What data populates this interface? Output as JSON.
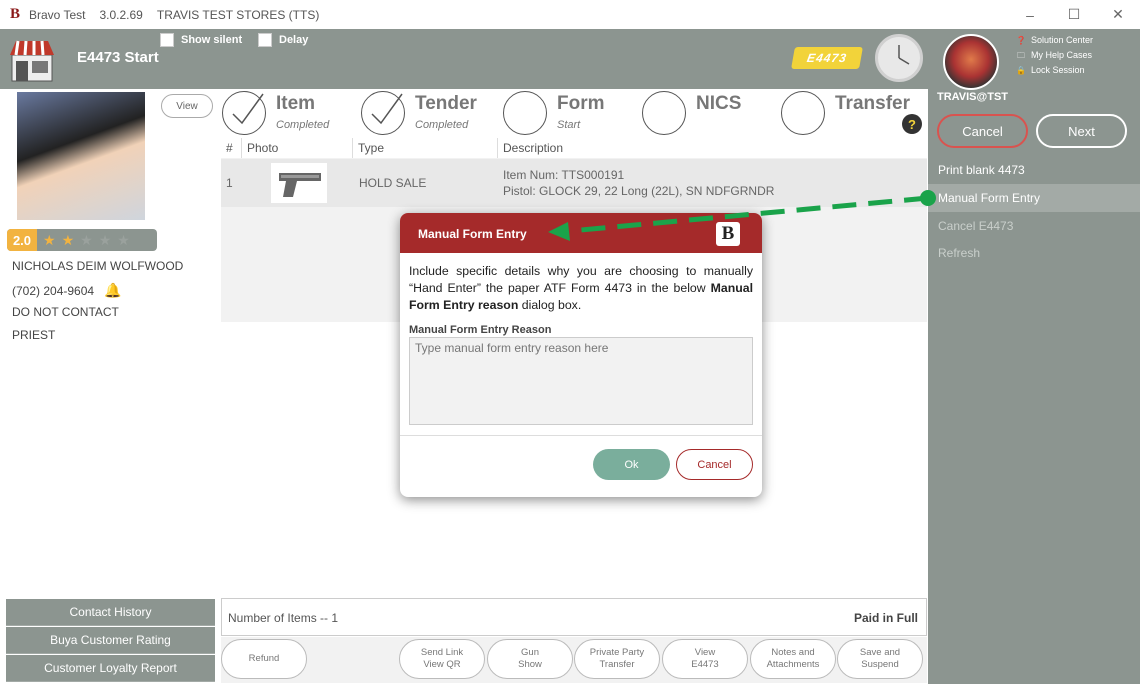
{
  "titlebar": {
    "app": "Bravo Test",
    "version": "3.0.2.69",
    "store": "TRAVIS TEST STORES (TTS)",
    "minimize": "–",
    "maximize": "☐",
    "close": "✕"
  },
  "header": {
    "title": "E4473 Start",
    "show_silent": "Show silent",
    "delay": "Delay",
    "badge": "E4473"
  },
  "account": {
    "username": "TRAVIS@TST",
    "links": [
      "Solution Center",
      "My Help Cases",
      "Lock Session"
    ],
    "cancel": "Cancel",
    "next": "Next",
    "menu": [
      {
        "label": "Print blank 4473",
        "state": "normal"
      },
      {
        "label": "Manual Form Entry",
        "state": "active"
      },
      {
        "label": "Cancel E4473",
        "state": "disabled"
      },
      {
        "label": "Refresh",
        "state": "disabled"
      }
    ]
  },
  "customer": {
    "view": "View",
    "rating": "2.0",
    "stars_filled": 2,
    "stars_total": 5,
    "name": "NICHOLAS DEIM WOLFWOOD",
    "phone": "(702) 204-9604",
    "contact": "DO NOT CONTACT",
    "occupation": "PRIEST",
    "buttons": [
      "Contact History",
      "Buya Customer Rating",
      "Customer Loyalty Report"
    ]
  },
  "steps": [
    {
      "name": "Item",
      "status": "Completed",
      "done": true
    },
    {
      "name": "Tender",
      "status": "Completed",
      "done": true
    },
    {
      "name": "Form",
      "status": "Start",
      "done": false
    },
    {
      "name": "NICS",
      "status": "",
      "done": false
    },
    {
      "name": "Transfer",
      "status": "",
      "done": false
    }
  ],
  "help_glyph": "?",
  "table": {
    "headers": [
      "#",
      "Photo",
      "Type",
      "Description"
    ],
    "rows": [
      {
        "num": "1",
        "type": "HOLD SALE",
        "desc1": "Item Num: TTS000191",
        "desc2": "Pistol: GLOCK 29, 22 Long (22L), SN NDFGRNDR"
      }
    ]
  },
  "footer": {
    "count": "Number of Items -- 1",
    "status": "Paid in Full"
  },
  "actions": [
    {
      "l1": "Refund",
      "l2": ""
    },
    {
      "l1": "Send Link",
      "l2": "View QR"
    },
    {
      "l1": "Gun",
      "l2": "Show"
    },
    {
      "l1": "Private Party",
      "l2": "Transfer"
    },
    {
      "l1": "View",
      "l2": "E4473"
    },
    {
      "l1": "Notes and",
      "l2": "Attachments"
    },
    {
      "l1": "Save and",
      "l2": "Suspend"
    }
  ],
  "modal": {
    "title": "Manual Form Entry",
    "logo": "B",
    "text_a": "Include specific details why you are choosing to manually “Hand Enter” the paper ATF Form 4473 in the below ",
    "text_bold": "Manual Form Entry reason",
    "text_b": " dialog box.",
    "field_label": "Manual Form Entry Reason",
    "placeholder": "Type manual form entry reason here",
    "value": "",
    "ok": "Ok",
    "cancel": "Cancel"
  },
  "colors": {
    "panel": "#8c9590",
    "accent_red": "#a52a2a",
    "ok_green": "#7aae9c",
    "arrow_green": "#1aa34a",
    "badge_yellow": "#f2d33a",
    "rating_orange": "#f2b340"
  }
}
